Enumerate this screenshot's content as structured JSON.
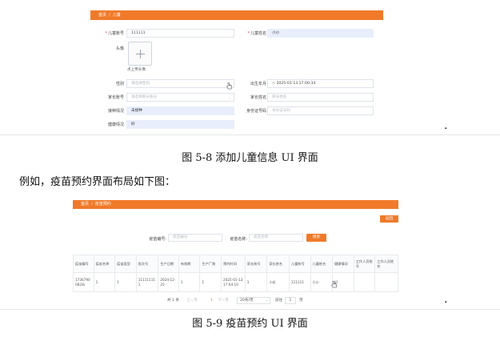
{
  "form_screen": {
    "breadcrumb": {
      "home": "首页",
      "separator": "/",
      "current": "儿童"
    },
    "fields": {
      "child_id": {
        "label": "儿童账号",
        "value": "111111"
      },
      "child_name": {
        "label": "儿童姓名",
        "value": "小小"
      },
      "avatar": {
        "label": "头像",
        "upload_text": "点上传头像"
      },
      "gender": {
        "label": "性别",
        "placeholder": "请选择性别"
      },
      "birthday": {
        "label": "出生年月",
        "value": "2025-01-13 17:00:34"
      },
      "parent_id": {
        "label": "家长账号",
        "placeholder": "请选择家长账号"
      },
      "parent_name": {
        "label": "家长姓名",
        "placeholder": "家长姓名"
      },
      "vaccination": {
        "label": "接种情况",
        "value": "未接种"
      },
      "id_card": {
        "label": "身份证号码",
        "placeholder": "身份证号码"
      },
      "health": {
        "label": "健康情况",
        "value": "好"
      }
    }
  },
  "caption_1": "图 5-8  添加儿童信息 UI 界面",
  "body_text": "例如，疫苗预约界面布局如下图：",
  "list_screen": {
    "breadcrumb": {
      "home": "首页",
      "separator": "/",
      "current": "疫苗预约"
    },
    "return_button": "返回",
    "search": {
      "vaccine_id_label": "疫苗编号:",
      "vaccine_id_placeholder": "疫苗编号",
      "vaccine_name_label": "疫苗名称:",
      "vaccine_name_placeholder": "疫苗名称",
      "button": "搜索"
    },
    "table": {
      "columns": [
        "疫苗编号",
        "疫苗名称",
        "疫苗类型",
        "批次号",
        "生产日期",
        "有效期",
        "生产厂商",
        "预约时间",
        "家长账号",
        "家长姓名",
        "儿童账号",
        "儿童姓名",
        "健康情况",
        "工作人员账号",
        "工作人员姓名"
      ],
      "rows": [
        [
          "1736790082/b",
          "1",
          "1",
          "111111111",
          "2024-12-25",
          "1",
          "1",
          "2025-01-13 17:04:10",
          "1",
          "小花",
          "111111",
          "小小",
          "好",
          "",
          ""
        ]
      ]
    },
    "pagination": {
      "total": "共 1 条",
      "prev": "上一页",
      "page": "1",
      "next": "下一页",
      "page_size": "20条/页",
      "goto_label": "前往",
      "goto_value": "1",
      "goto_suffix": "页"
    }
  },
  "caption_2": "图 5-9  疫苗预约 UI 界面",
  "colors": {
    "accent": "#f07a2a",
    "input_fill": "#e8eefb",
    "rule": "#3b4a8a"
  }
}
